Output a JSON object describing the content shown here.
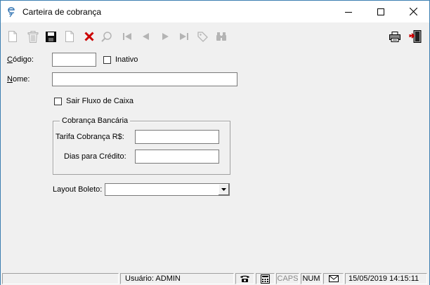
{
  "window": {
    "title": "Carteira de cobrança"
  },
  "toolbar": {
    "items": [
      {
        "icon": "new-document-icon",
        "enabled": false
      },
      {
        "icon": "trash-icon",
        "enabled": false
      },
      {
        "icon": "save-icon",
        "enabled": true
      },
      {
        "icon": "blank-page-icon",
        "enabled": false
      },
      {
        "icon": "delete-x-icon",
        "enabled": true
      },
      {
        "icon": "search-icon",
        "enabled": false
      },
      {
        "icon": "first-record-icon",
        "enabled": false
      },
      {
        "icon": "previous-record-icon",
        "enabled": false
      },
      {
        "icon": "next-record-icon",
        "enabled": false
      },
      {
        "icon": "last-record-icon",
        "enabled": false
      },
      {
        "icon": "tag-icon",
        "enabled": false
      },
      {
        "icon": "binoculars-icon",
        "enabled": false
      },
      {
        "icon": "printer-icon",
        "enabled": true
      },
      {
        "icon": "exit-door-icon",
        "enabled": true
      }
    ]
  },
  "form": {
    "codigo_label_underlined": "C",
    "codigo_label_rest": "ódigo:",
    "codigo_value": "",
    "inativo_label": "Inativo",
    "inativo_checked": false,
    "nome_label_underlined": "N",
    "nome_label_rest": "ome:",
    "nome_value": "",
    "sair_fluxo_label": "Sair Fluxo de Caixa",
    "sair_fluxo_checked": false,
    "group_title": "Cobrança Bancária",
    "tarifa_label": "Tarifa Cobrança R$:",
    "tarifa_value": "",
    "dias_label": "Dias para Crédito:",
    "dias_value": "",
    "layout_label": "Layout Boleto:",
    "layout_value": ""
  },
  "statusbar": {
    "user": "Usuário: ADMIN",
    "caps": "CAPS",
    "num": "NUM",
    "datetime": "15/05/2019 14:15:11"
  },
  "colors": {
    "accent": "#3c7fb1",
    "delete_red": "#cc0000",
    "disabled_icon": "#b4b4b4"
  }
}
